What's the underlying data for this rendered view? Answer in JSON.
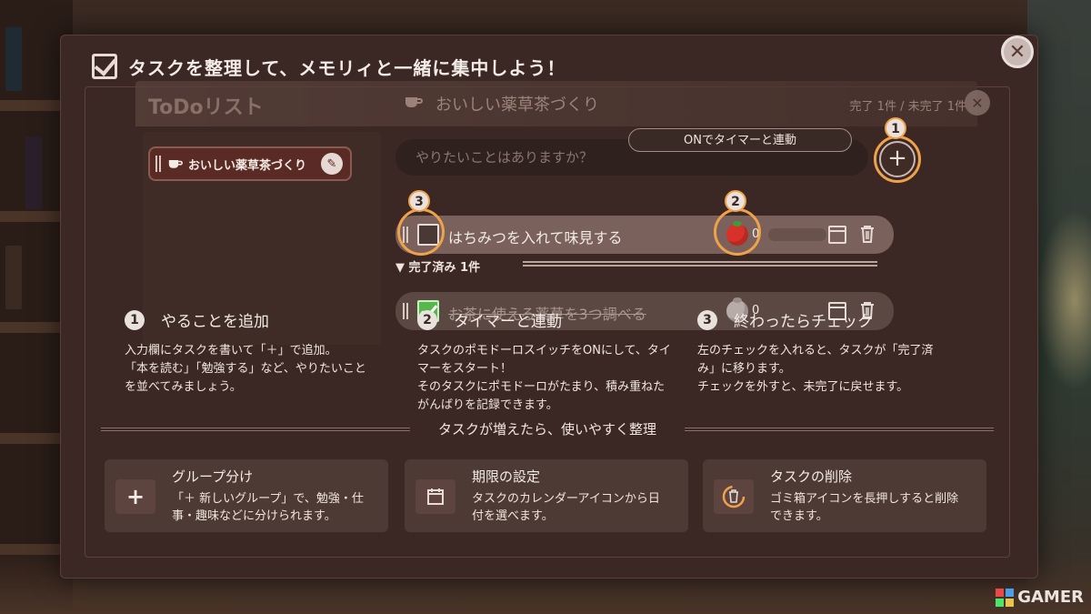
{
  "header": {
    "title": "タスクを整理して、メモリィと一緒に集中しよう！"
  },
  "app": {
    "todo_title": "ToDoリスト",
    "group_title": "おいしい薬草茶づくり",
    "progress": "完了 1件 / 未完了 1件",
    "sidebar_item": "おいしい薬草茶づくり",
    "input_placeholder": "やりたいことはありますか？",
    "timer_tip": "ONでタイマーと連動",
    "tasks": [
      {
        "label": "はちみつを入れて味見する",
        "tomatoes": "0",
        "checked": false
      },
      {
        "label": "お茶に使える薬草を3つ調べる",
        "tomatoes": "0",
        "checked": true
      }
    ],
    "done_header": "▼ 完了済み 1件",
    "callouts": [
      "1",
      "2",
      "3"
    ]
  },
  "steps": [
    {
      "num": "1",
      "title": "やることを追加",
      "body": [
        "入力欄にタスクを書いて「＋」で追加。",
        "「本を読む」「勉強する」など、やりたいこと",
        "を並べてみましょう。"
      ]
    },
    {
      "num": "2",
      "title": "タイマーと連動",
      "body": [
        "タスクのポモドーロスイッチをONにして、タイ",
        "マーをスタート！",
        "そのタスクにポモドーロがたまり、積み重ねた",
        "がんばりを記録できます。"
      ]
    },
    {
      "num": "3",
      "title": "終わったらチェック",
      "body": [
        "左のチェックを入れると、タスクが「完了済",
        "み」に移ります。",
        "チェックを外すと、未完了に戻せます。"
      ]
    }
  ],
  "section_title": "タスクが増えたら、使いやすく整理",
  "cards": [
    {
      "title": "グループ分け",
      "desc": [
        "「＋ 新しいグループ」で、勉強・仕",
        "事・趣味などに分けられます。"
      ],
      "icon": "plus-icon"
    },
    {
      "title": "期限の設定",
      "desc": [
        "タスクのカレンダーアイコンから日",
        "付を選べます。"
      ],
      "icon": "calendar-icon"
    },
    {
      "title": "タスクの削除",
      "desc": [
        "ゴミ箱アイコンを長押しすると削除",
        "できます。"
      ],
      "icon": "trash-icon"
    }
  ],
  "watermark": "GAMER",
  "colors": {
    "accent_ring": "#f0a24a",
    "modal_bg": "#3b2824",
    "tomato": "#d8312a",
    "check_green": "#56b84a"
  }
}
